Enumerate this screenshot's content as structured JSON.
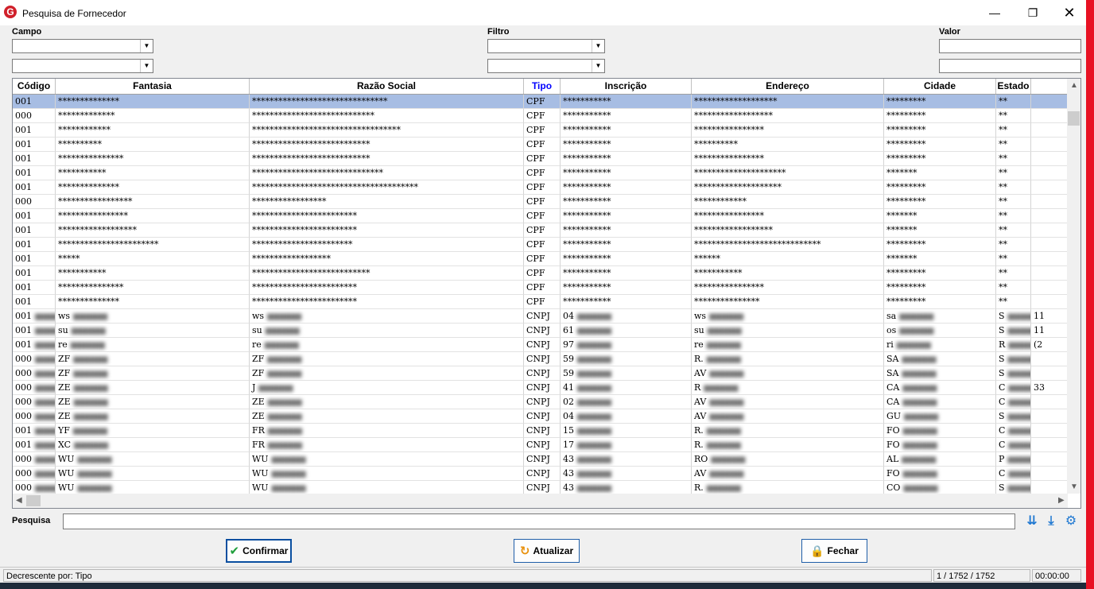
{
  "window": {
    "title": "Pesquisa de Fornecedor"
  },
  "filters": {
    "campo_label": "Campo",
    "filtro_label": "Filtro",
    "valor_label": "Valor"
  },
  "columns": [
    "Código",
    "Fantasia",
    "Razão Social",
    "Tipo",
    "Inscrição",
    "Endereço",
    "Cidade",
    "Estado"
  ],
  "rows": [
    {
      "codigo": "001",
      "fantasia": "**************",
      "razao": "*******************************",
      "tipo": "CPF",
      "inscricao": "***********",
      "endereco": "*******************",
      "cidade": "*********",
      "estado": "**"
    },
    {
      "codigo": "000",
      "fantasia": "*************",
      "razao": "****************************",
      "tipo": "CPF",
      "inscricao": "***********",
      "endereco": "******************",
      "cidade": "*********",
      "estado": "**"
    },
    {
      "codigo": "001",
      "fantasia": "************",
      "razao": "**********************************",
      "tipo": "CPF",
      "inscricao": "***********",
      "endereco": "****************",
      "cidade": "*********",
      "estado": "**"
    },
    {
      "codigo": "001",
      "fantasia": "**********",
      "razao": "***************************",
      "tipo": "CPF",
      "inscricao": "***********",
      "endereco": "**********",
      "cidade": "*********",
      "estado": "**"
    },
    {
      "codigo": "001",
      "fantasia": "***************",
      "razao": "***************************",
      "tipo": "CPF",
      "inscricao": "***********",
      "endereco": "****************",
      "cidade": "*********",
      "estado": "**"
    },
    {
      "codigo": "001",
      "fantasia": "***********",
      "razao": "******************************",
      "tipo": "CPF",
      "inscricao": "***********",
      "endereco": "*********************",
      "cidade": "*******",
      "estado": "**"
    },
    {
      "codigo": "001",
      "fantasia": "**************",
      "razao": "**************************************",
      "tipo": "CPF",
      "inscricao": "***********",
      "endereco": "********************",
      "cidade": "*********",
      "estado": "**"
    },
    {
      "codigo": "000",
      "fantasia": "*****************",
      "razao": "*****************",
      "tipo": "CPF",
      "inscricao": "***********",
      "endereco": "************",
      "cidade": "*********",
      "estado": "**"
    },
    {
      "codigo": "001",
      "fantasia": "****************",
      "razao": "************************",
      "tipo": "CPF",
      "inscricao": "***********",
      "endereco": "****************",
      "cidade": "*******",
      "estado": "**"
    },
    {
      "codigo": "001",
      "fantasia": "******************",
      "razao": "************************",
      "tipo": "CPF",
      "inscricao": "***********",
      "endereco": "******************",
      "cidade": "*******",
      "estado": "**"
    },
    {
      "codigo": "001",
      "fantasia": "***********************",
      "razao": "***********************",
      "tipo": "CPF",
      "inscricao": "***********",
      "endereco": "*****************************",
      "cidade": "*********",
      "estado": "**"
    },
    {
      "codigo": "001",
      "fantasia": "*****",
      "razao": "******************",
      "tipo": "CPF",
      "inscricao": "***********",
      "endereco": "******",
      "cidade": "*******",
      "estado": "**"
    },
    {
      "codigo": "001",
      "fantasia": "***********",
      "razao": "***************************",
      "tipo": "CPF",
      "inscricao": "***********",
      "endereco": "***********",
      "cidade": "*********",
      "estado": "**"
    },
    {
      "codigo": "001",
      "fantasia": "***************",
      "razao": "************************",
      "tipo": "CPF",
      "inscricao": "***********",
      "endereco": "****************",
      "cidade": "*********",
      "estado": "**"
    },
    {
      "codigo": "001",
      "fantasia": "**************",
      "razao": "************************",
      "tipo": "CPF",
      "inscricao": "***********",
      "endereco": "***************",
      "cidade": "*********",
      "estado": "**"
    },
    {
      "codigo": "001",
      "fantasia": "ws",
      "razao": "ws",
      "tipo": "CNPJ",
      "inscricao": "04",
      "endereco": "ws",
      "cidade": "sa",
      "estado": "S",
      "extra": "11"
    },
    {
      "codigo": "001",
      "fantasia": "su",
      "razao": "su",
      "tipo": "CNPJ",
      "inscricao": "61",
      "endereco": "su",
      "cidade": "os",
      "estado": "S",
      "extra": "11"
    },
    {
      "codigo": "001",
      "fantasia": "re",
      "razao": "re",
      "tipo": "CNPJ",
      "inscricao": "97",
      "endereco": "re",
      "cidade": "ri",
      "estado": "R",
      "extra": "(2"
    },
    {
      "codigo": "000",
      "fantasia": "ZF",
      "razao": "ZF",
      "tipo": "CNPJ",
      "inscricao": "59",
      "endereco": "R.",
      "cidade": "SA",
      "estado": "S",
      "extra": ""
    },
    {
      "codigo": "000",
      "fantasia": "ZF",
      "razao": "ZF",
      "tipo": "CNPJ",
      "inscricao": "59",
      "endereco": "AV",
      "cidade": "SA",
      "estado": "S",
      "extra": ""
    },
    {
      "codigo": "000",
      "fantasia": "ZE",
      "razao": "J",
      "tipo": "CNPJ",
      "inscricao": "41",
      "endereco": "R",
      "cidade": "CA",
      "estado": "C",
      "extra": "33"
    },
    {
      "codigo": "000",
      "fantasia": "ZE",
      "razao": "ZE",
      "tipo": "CNPJ",
      "inscricao": "02",
      "endereco": "AV",
      "cidade": "CA",
      "estado": "C",
      "extra": ""
    },
    {
      "codigo": "000",
      "fantasia": "ZE",
      "razao": "ZE",
      "tipo": "CNPJ",
      "inscricao": "04",
      "endereco": "AV",
      "cidade": "GU",
      "estado": "S",
      "extra": ""
    },
    {
      "codigo": "001",
      "fantasia": "YF",
      "razao": "FR",
      "tipo": "CNPJ",
      "inscricao": "15",
      "endereco": "R.",
      "cidade": "FO",
      "estado": "C",
      "extra": ""
    },
    {
      "codigo": "001",
      "fantasia": "XC",
      "razao": "FR",
      "tipo": "CNPJ",
      "inscricao": "17",
      "endereco": "R.",
      "cidade": "FO",
      "estado": "C",
      "extra": ""
    },
    {
      "codigo": "000",
      "fantasia": "WU",
      "razao": "WU",
      "tipo": "CNPJ",
      "inscricao": "43",
      "endereco": "RO",
      "cidade": "AL",
      "estado": "P",
      "extra": ""
    },
    {
      "codigo": "000",
      "fantasia": "WU",
      "razao": "WU",
      "tipo": "CNPJ",
      "inscricao": "43",
      "endereco": "AV",
      "cidade": "FO",
      "estado": "C",
      "extra": ""
    },
    {
      "codigo": "000",
      "fantasia": "WU",
      "razao": "WU",
      "tipo": "CNPJ",
      "inscricao": "43",
      "endereco": "R.",
      "cidade": "CO",
      "estado": "S",
      "extra": ""
    }
  ],
  "search": {
    "label": "Pesquisa"
  },
  "buttons": {
    "confirm": "Confirmar",
    "refresh": "Atualizar",
    "close": "Fechar"
  },
  "status": {
    "sort": "Decrescente por: Tipo",
    "records": "1 / 1752 / 1752",
    "time": "00:00:00"
  },
  "colors": {
    "selected_row": "#a7bde3",
    "accent_blue": "#1f78d1",
    "tipo_header": "#0000ff",
    "red_edge": "#e81123"
  }
}
